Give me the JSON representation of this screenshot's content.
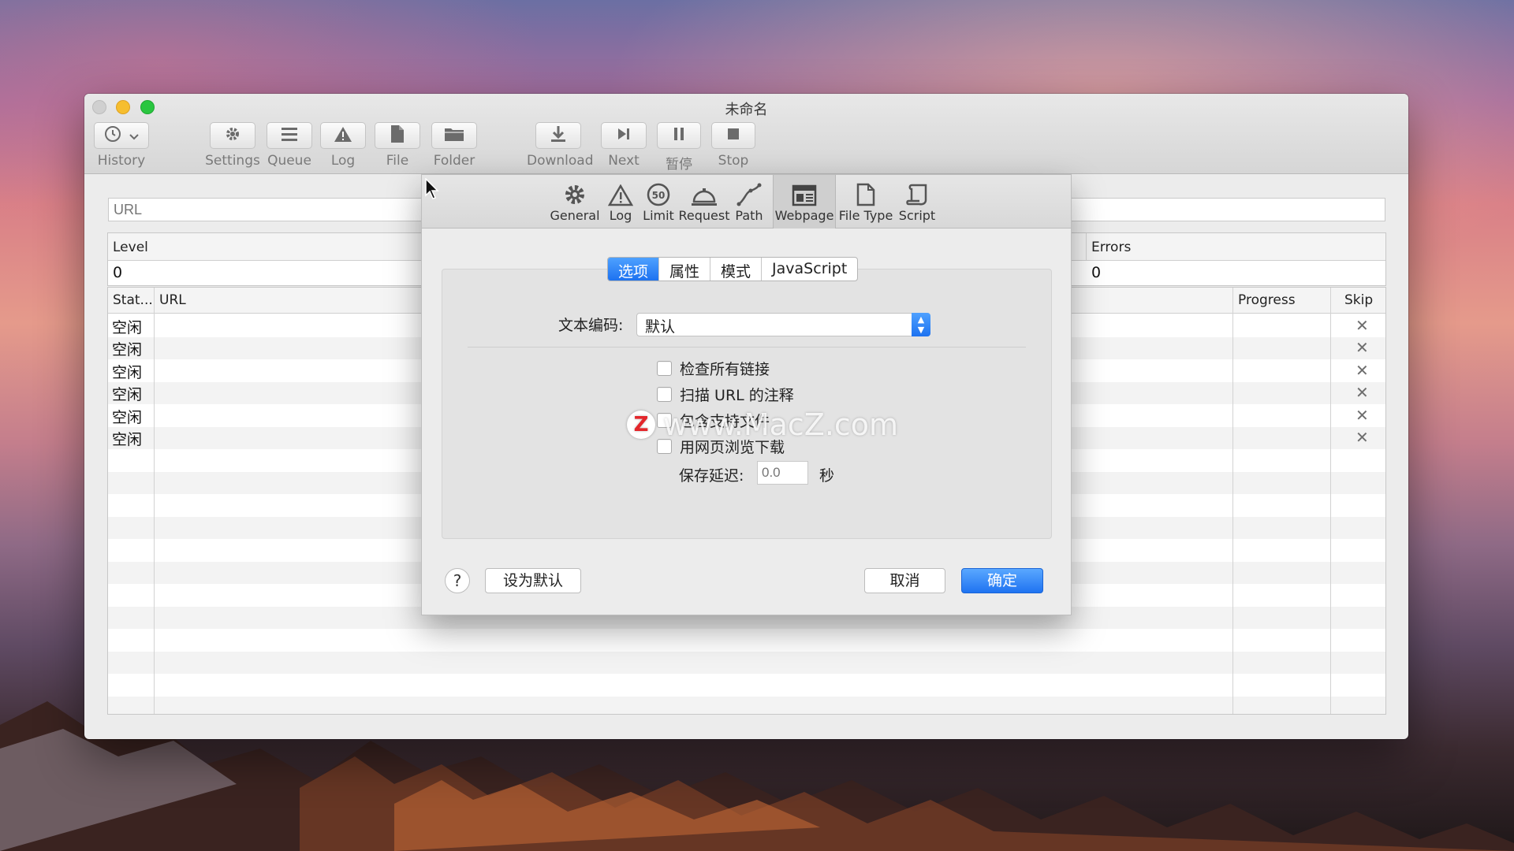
{
  "window": {
    "title": "未命名"
  },
  "toolbar": {
    "history": "History",
    "settings": "Settings",
    "queue": "Queue",
    "log": "Log",
    "file": "File",
    "folder": "Folder",
    "download": "Download",
    "next": "Next",
    "pause": "暂停",
    "stop": "Stop"
  },
  "url_field": {
    "placeholder": "URL"
  },
  "stats": {
    "level_label": "Level",
    "level_value": "0",
    "errors_label": "Errors",
    "errors_value": "0"
  },
  "table": {
    "columns": {
      "status": "Stat...",
      "url": "URL",
      "progress": "Progress",
      "skip": "Skip"
    },
    "rows": [
      {
        "status": "空闲",
        "skip_icon": "close-icon"
      },
      {
        "status": "空闲",
        "skip_icon": "close-icon"
      },
      {
        "status": "空闲",
        "skip_icon": "close-icon"
      },
      {
        "status": "空闲",
        "skip_icon": "close-icon"
      },
      {
        "status": "空闲",
        "skip_icon": "close-icon"
      },
      {
        "status": "空闲",
        "skip_icon": "close-icon"
      }
    ]
  },
  "prefs": {
    "tabs": [
      {
        "label": "General",
        "icon": "gear-icon"
      },
      {
        "label": "Log",
        "icon": "warning-icon"
      },
      {
        "label": "Limit",
        "icon": "speed-limit-icon"
      },
      {
        "label": "Request",
        "icon": "service-bell-icon"
      },
      {
        "label": "Path",
        "icon": "path-icon"
      },
      {
        "label": "Webpage",
        "icon": "webpage-icon"
      },
      {
        "label": "File Type",
        "icon": "document-icon"
      },
      {
        "label": "Script",
        "icon": "script-icon"
      }
    ],
    "active_tab": "Webpage",
    "segments": [
      "选项",
      "属性",
      "模式",
      "JavaScript"
    ],
    "selected_segment": "选项",
    "encoding_label": "文本编码:",
    "encoding_value": "默认",
    "checkboxes": [
      "检查所有链接",
      "扫描 URL 的注释",
      "包含支持文件",
      "用网页浏览下载"
    ],
    "delay_label": "保存延迟:",
    "delay_placeholder": "0.0",
    "delay_unit": "秒",
    "help": "?",
    "set_default": "设为默认",
    "cancel": "取消",
    "ok": "确定"
  },
  "watermark": {
    "logo": "Z",
    "text": "www.MacZ.com"
  },
  "colors": {
    "accent": "#1d72f0",
    "window_bg": "#ececec"
  }
}
